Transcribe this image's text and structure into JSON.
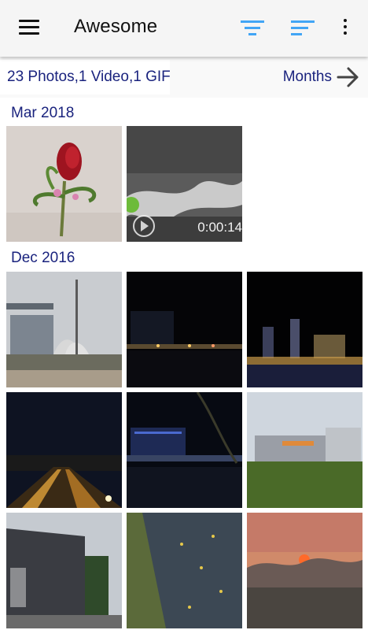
{
  "appbar": {
    "title": "Awesome",
    "icons": [
      "menu-icon",
      "filter-icon",
      "sort-icon",
      "more-vert-icon"
    ],
    "accent_color": "#42a5f5"
  },
  "info": {
    "summary": "23 Photos,1 Video,1 GIF",
    "months_label": "Months",
    "text_color": "#1a237e"
  },
  "sections": [
    {
      "label": "Mar 2018",
      "items": [
        {
          "kind": "photo",
          "subject": "red rose boutonniere"
        },
        {
          "kind": "video",
          "subject": "water on gravel",
          "duration": "0:00:14"
        }
      ]
    },
    {
      "label": "Dec 2016",
      "items": [
        {
          "kind": "photo",
          "subject": "marina bay sands daytime"
        },
        {
          "kind": "photo",
          "subject": "marina bay night"
        },
        {
          "kind": "photo",
          "subject": "city skyline night"
        },
        {
          "kind": "photo",
          "subject": "highway night"
        },
        {
          "kind": "photo",
          "subject": "waterfront night tree"
        },
        {
          "kind": "photo",
          "subject": "buildings and grass field"
        },
        {
          "kind": "photo",
          "subject": "mall building nex"
        },
        {
          "kind": "photo",
          "subject": "leaves on pavement"
        },
        {
          "kind": "photo",
          "subject": "sunset over trees"
        }
      ]
    }
  ]
}
